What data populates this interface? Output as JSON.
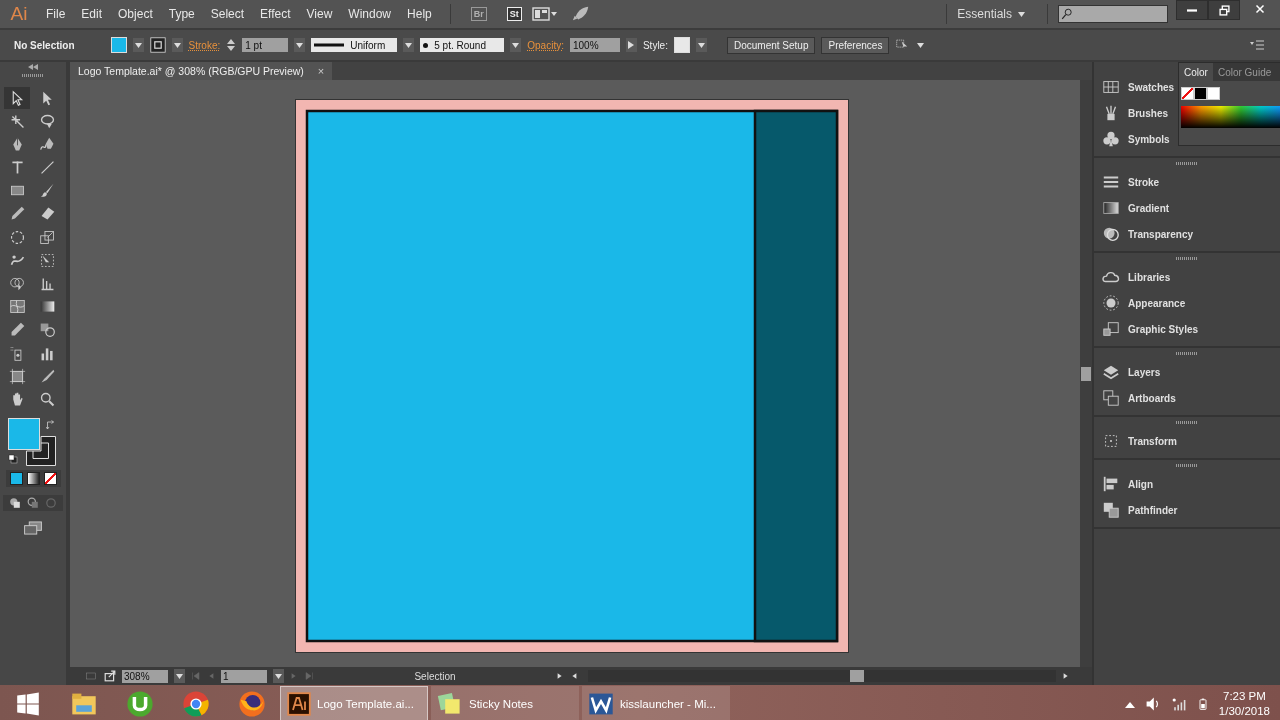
{
  "menu_bar": {
    "logo": "Ai",
    "items": [
      "File",
      "Edit",
      "Object",
      "Type",
      "Select",
      "Effect",
      "View",
      "Window",
      "Help"
    ],
    "bridge": "Br",
    "stock": "St",
    "workspace": "Essentials"
  },
  "control_bar": {
    "selection": "No Selection",
    "stroke_label": "Stroke:",
    "stroke_weight": "1 pt",
    "profile": "Uniform",
    "brush": "5 pt. Round",
    "opacity_label": "Opacity:",
    "opacity": "100%",
    "style_label": "Style:",
    "buttons": [
      "Document Setup",
      "Preferences"
    ]
  },
  "document_tab": {
    "title": "Logo Template.ai* @ 308% (RGB/GPU Preview)",
    "close": "×"
  },
  "tools": [
    {
      "selected": true
    },
    {
      "selected": false
    },
    {
      "selected": false
    },
    {
      "selected": false
    },
    {
      "selected": false
    },
    {
      "selected": false
    },
    {
      "selected": false
    },
    {
      "selected": false
    },
    {
      "selected": false
    },
    {
      "selected": false
    },
    {
      "selected": false
    },
    {
      "selected": false
    },
    {
      "selected": false
    },
    {
      "selected": false
    },
    {
      "selected": false
    },
    {
      "selected": false
    },
    {
      "selected": false
    },
    {
      "selected": false
    },
    {
      "selected": false
    },
    {
      "selected": false
    },
    {
      "selected": false
    },
    {
      "selected": false
    },
    {
      "selected": false
    },
    {
      "selected": false
    },
    {
      "selected": false
    },
    {
      "selected": false
    },
    {
      "selected": false
    },
    {
      "selected": false
    }
  ],
  "fill_swatch": {
    "color": "#1ab8e8"
  },
  "color_panel": {
    "tabs": [
      {
        "label": "Color",
        "selected": true
      },
      {
        "label": "Color Guide",
        "selected": false
      }
    ]
  },
  "panel_groups": [
    [
      "Swatches",
      "Brushes",
      "Symbols"
    ],
    [
      "Stroke",
      "Gradient",
      "Transparency"
    ],
    [
      "Libraries",
      "Appearance",
      "Graphic Styles"
    ],
    [
      "Layers",
      "Artboards"
    ],
    [
      "Transform"
    ],
    [
      "Align",
      "Pathfinder"
    ]
  ],
  "status_bar": {
    "zoom": "308%",
    "artboard": "1",
    "status": "Selection"
  },
  "taskbar": {
    "windows": [
      {
        "label": "Logo Template.ai...",
        "selected": true,
        "kind": "illustrator"
      },
      {
        "label": "Sticky Notes",
        "selected": false,
        "kind": "notes"
      },
      {
        "label": "kisslauncher - Mi...",
        "selected": false,
        "kind": "word"
      }
    ],
    "time": "7:23 PM",
    "date": "1/30/2018"
  }
}
